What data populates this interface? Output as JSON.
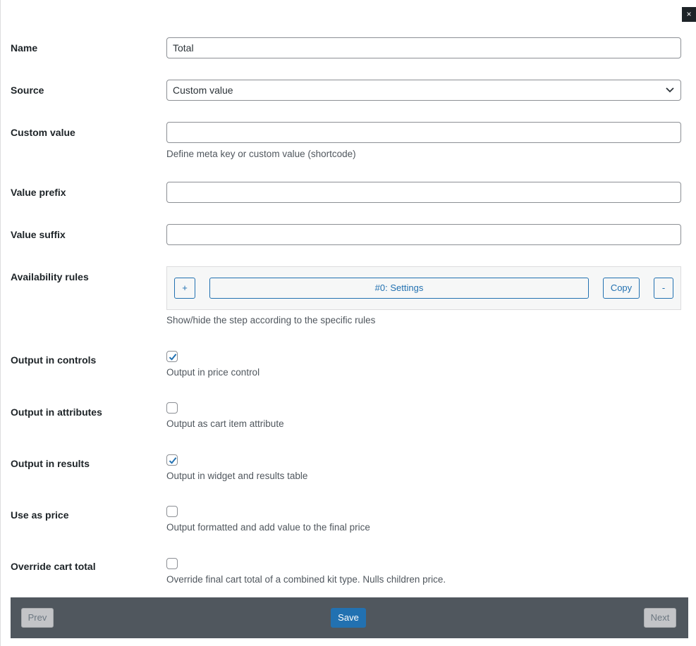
{
  "close_label": "×",
  "fields": {
    "name": {
      "label": "Name",
      "value": "Total"
    },
    "source": {
      "label": "Source",
      "value": "Custom value"
    },
    "custom_value": {
      "label": "Custom value",
      "value": "",
      "description": "Define meta key or custom value (shortcode)"
    },
    "value_prefix": {
      "label": "Value prefix",
      "value": ""
    },
    "value_suffix": {
      "label": "Value suffix",
      "value": ""
    },
    "availability_rules": {
      "label": "Availability rules",
      "add_label": "+",
      "rule_label": "#0: Settings",
      "copy_label": "Copy",
      "remove_label": "-",
      "description": "Show/hide the step according to the specific rules"
    },
    "output_in_controls": {
      "label": "Output in controls",
      "checked": true,
      "description": "Output in price control"
    },
    "output_in_attributes": {
      "label": "Output in attributes",
      "checked": false,
      "description": "Output as cart item attribute"
    },
    "output_in_results": {
      "label": "Output in results",
      "checked": true,
      "description": "Output in widget and results table"
    },
    "use_as_price": {
      "label": "Use as price",
      "checked": false,
      "description": "Output formatted and add value to the final price"
    },
    "override_cart_total": {
      "label": "Override cart total",
      "checked": false,
      "description": "Override final cart total of a combined kit type. Nulls children price."
    }
  },
  "footer": {
    "prev_label": "Prev",
    "save_label": "Save",
    "next_label": "Next"
  },
  "colors": {
    "accent": "#2271b1",
    "footer_bg": "#50575e"
  }
}
